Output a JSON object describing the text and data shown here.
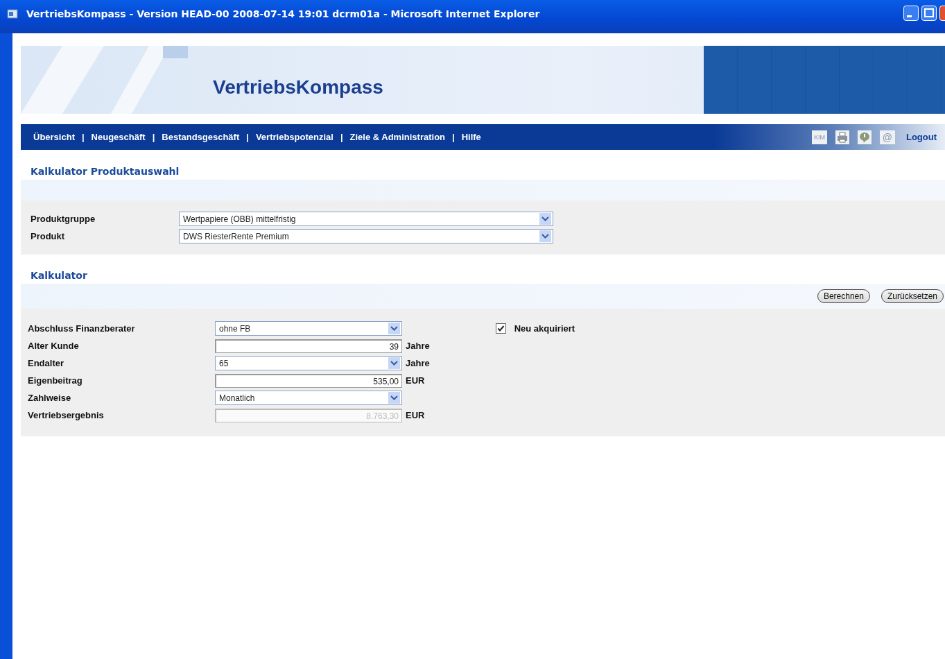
{
  "window": {
    "title": "VertriebsKompass - Version HEAD-00 2008-07-14 19:01 dcrm01a - Microsoft Internet Explorer"
  },
  "banner": {
    "title": "VertriebsKompass"
  },
  "nav": {
    "items": [
      {
        "label": "Übersicht"
      },
      {
        "label": "Neugeschäft"
      },
      {
        "label": "Bestandsgeschäft"
      },
      {
        "label": "Vertriebspotenzial"
      },
      {
        "label": "Ziele & Administration"
      },
      {
        "label": "Hilfe"
      }
    ],
    "separator": "|",
    "tools": [
      {
        "kind": "text",
        "label": "KIM"
      },
      {
        "kind": "printer"
      },
      {
        "kind": "bubble"
      },
      {
        "kind": "text",
        "label": "@"
      }
    ],
    "logout": "Logout"
  },
  "product_section": {
    "title": "Kalkulator Produktauswahl",
    "rows": [
      {
        "label": "Produktgruppe",
        "value": "Wertpapiere (OBB) mittelfristig"
      },
      {
        "label": "Produkt",
        "value": "DWS RiesterRente Premium"
      }
    ]
  },
  "calculator": {
    "title": "Kalkulator",
    "buttons": [
      "Berechnen",
      "Zurücksetzen"
    ],
    "rows": [
      {
        "label": "Abschluss Finanzberater",
        "kind": "select",
        "value": "ohne FB"
      },
      {
        "label": "Alter Kunde",
        "kind": "input",
        "value": "39",
        "unit": "Jahre",
        "disabled": false
      },
      {
        "label": "Endalter",
        "kind": "select",
        "value": "65",
        "unit": "Jahre"
      },
      {
        "label": "Eigenbeitrag",
        "kind": "input",
        "value": "535,00",
        "unit": "EUR",
        "disabled": false
      },
      {
        "label": "Zahlweise",
        "kind": "select",
        "value": "Monatlich"
      },
      {
        "label": "Vertriebsergebnis",
        "kind": "input",
        "value": "8.763,30",
        "unit": "EUR",
        "disabled": true
      }
    ],
    "checkbox": {
      "label": "Neu akquiriert",
      "checked": true
    }
  }
}
